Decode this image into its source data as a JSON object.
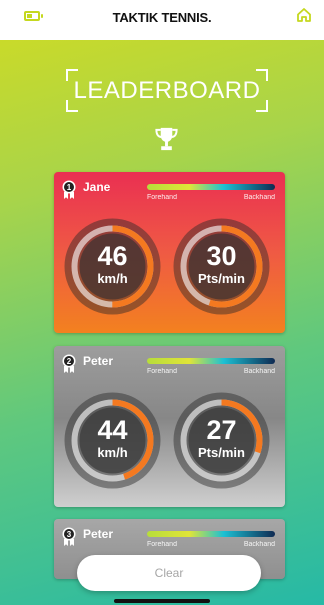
{
  "header": {
    "brand": "TAKTIK TENNIS."
  },
  "page": {
    "title": "LEADERBOARD"
  },
  "labels": {
    "forehand": "Forehand",
    "backhand": "Backhand"
  },
  "players": [
    {
      "rank": "1",
      "name": "Jane",
      "speed_value": "46",
      "speed_unit": "km/h",
      "rate_value": "30",
      "rate_unit": "Pts/min",
      "speed_fill": 0.5,
      "rate_fill": 0.55
    },
    {
      "rank": "2",
      "name": "Peter",
      "speed_value": "44",
      "speed_unit": "km/h",
      "rate_value": "27",
      "rate_unit": "Pts/min",
      "speed_fill": 0.45,
      "rate_fill": 0.3
    },
    {
      "rank": "3",
      "name": "Peter"
    }
  ],
  "actions": {
    "clear_label": "Clear"
  },
  "colors": {
    "accent": "#c5d81f",
    "gauge_arc": "#f47920",
    "card_first": "#ea2f52",
    "card_other": "#9d9d9d"
  }
}
